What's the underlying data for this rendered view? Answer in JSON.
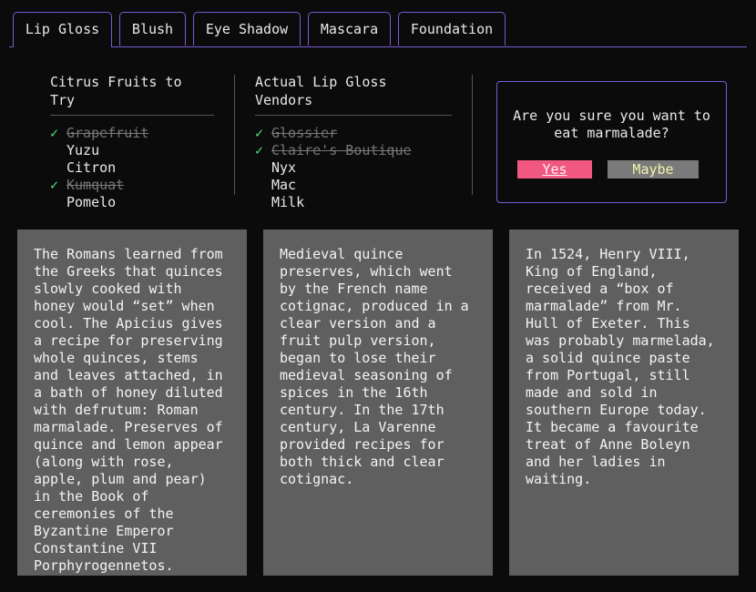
{
  "tabs": [
    {
      "label": "Lip Gloss",
      "active": true
    },
    {
      "label": "Blush",
      "active": false
    },
    {
      "label": "Eye Shadow",
      "active": false
    },
    {
      "label": "Mascara",
      "active": false
    },
    {
      "label": "Foundation",
      "active": false
    }
  ],
  "citrus_list": {
    "title": "Citrus Fruits to Try",
    "items": [
      {
        "label": "Grapefruit",
        "checked": true
      },
      {
        "label": "Yuzu",
        "checked": false
      },
      {
        "label": "Citron",
        "checked": false
      },
      {
        "label": "Kumquat",
        "checked": true
      },
      {
        "label": "Pomelo",
        "checked": false
      }
    ]
  },
  "vendor_list": {
    "title": "Actual Lip Gloss Vendors",
    "items": [
      {
        "label": "Glossier",
        "checked": true
      },
      {
        "label": "Claire's Boutique",
        "checked": true
      },
      {
        "label": "Nyx",
        "checked": false
      },
      {
        "label": "Mac",
        "checked": false
      },
      {
        "label": "Milk",
        "checked": false
      }
    ]
  },
  "check_glyph": "✓",
  "dialog": {
    "message": "Are you sure you want to eat marmalade?",
    "yes_label": "Yes",
    "maybe_label": "Maybe"
  },
  "panels": [
    {
      "text": "The Romans learned from the Greeks that quinces slowly cooked with honey would “set” when cool. The Apicius gives a recipe for preserving whole quinces, stems and leaves attached, in a bath of honey diluted with defrutum: Roman marmalade. Preserves of quince and lemon appear (along with rose, apple, plum and pear) in the Book of ceremonies of the Byzantine Emperor Constantine VII Porphyrogennetos."
    },
    {
      "text": "Medieval quince preserves, which went by the French name cotignac, produced in a clear version and a fruit pulp version, began to lose their medieval seasoning of spices in the 16th century. In the 17th century, La Varenne provided recipes for both thick and clear cotignac."
    },
    {
      "text": "In 1524, Henry VIII, King of England, received a “box of marmalade” from Mr. Hull of Exeter. This was probably marmelada, a solid quince paste from Portugal, still made and sold in southern Europe today. It became a favourite treat of Anne Boleyn and her ladies in waiting."
    }
  ],
  "colors": {
    "accent": "#7b5bd6",
    "check": "#4ee07a",
    "yes_button": "#f0587f",
    "maybe_button": "#7a7a7a",
    "panel_bg": "#5f5f5f",
    "background": "#0b0b0b"
  }
}
